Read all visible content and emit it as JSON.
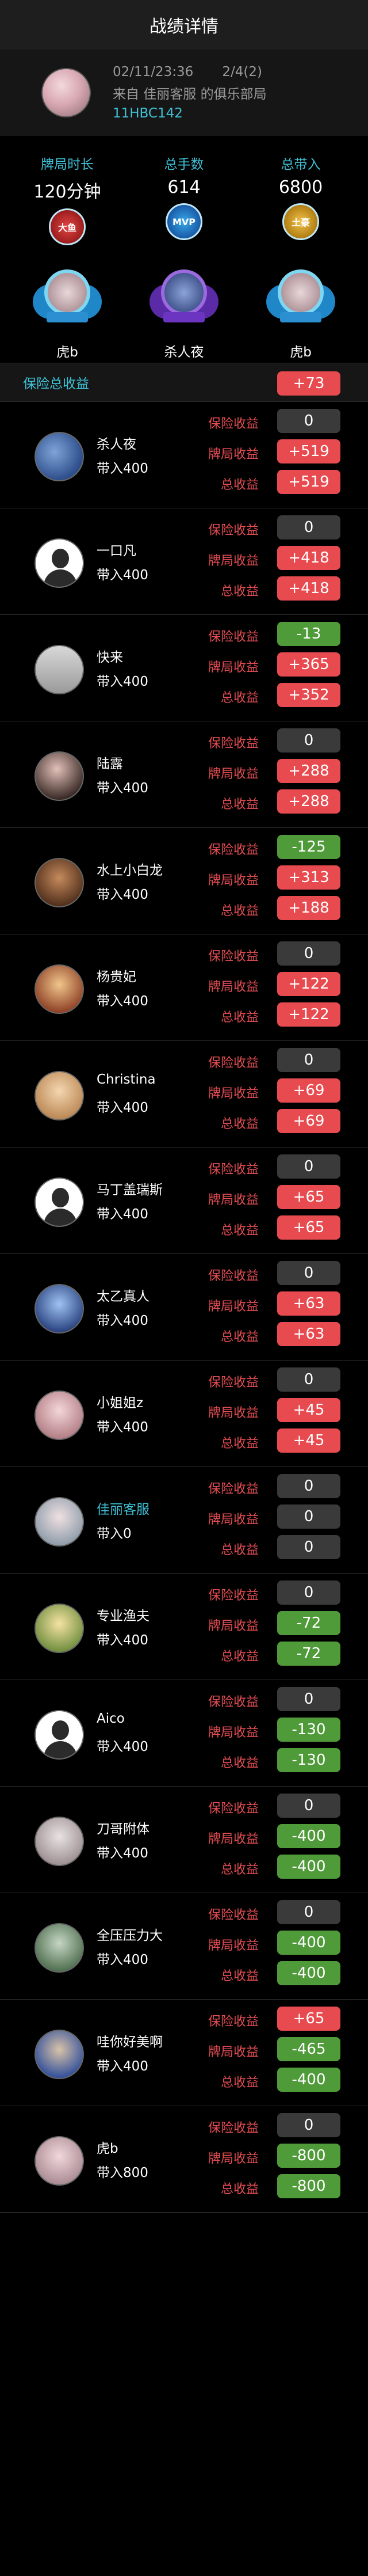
{
  "header": {
    "title": "战绩详情"
  },
  "game": {
    "datetime": "02/11/23:36",
    "hands_ratio": "2/4(2)",
    "club_line": "来自 佳丽客服 的俱乐部局",
    "game_id": "11HBC142"
  },
  "summary": {
    "duration": {
      "label": "牌局时长",
      "value": "120分钟",
      "badge": "大鱼"
    },
    "hands": {
      "label": "总手数",
      "value": "614",
      "badge": "MVP"
    },
    "buyin": {
      "label": "总带入",
      "value": "6800",
      "badge": "土豪"
    },
    "winners": [
      "虎b",
      "杀人夜",
      "虎b"
    ]
  },
  "insurance_total": {
    "label": "保险总收益",
    "value": "+73"
  },
  "labels": {
    "insurance": "保险收益",
    "hand": "牌局收益",
    "total": "总收益"
  },
  "players": [
    {
      "name": "杀人夜",
      "buyin": "带入400",
      "insurance": "0",
      "hand": "+519",
      "total": "+519"
    },
    {
      "name": "一口凡",
      "buyin": "带入400",
      "insurance": "0",
      "hand": "+418",
      "total": "+418"
    },
    {
      "name": "快来",
      "buyin": "带入400",
      "insurance": "-13",
      "hand": "+365",
      "total": "+352"
    },
    {
      "name": "陆露",
      "buyin": "带入400",
      "insurance": "0",
      "hand": "+288",
      "total": "+288"
    },
    {
      "name": "水上小白龙",
      "buyin": "带入400",
      "insurance": "-125",
      "hand": "+313",
      "total": "+188"
    },
    {
      "name": "杨贵妃",
      "buyin": "带入400",
      "insurance": "0",
      "hand": "+122",
      "total": "+122"
    },
    {
      "name": "Christina",
      "buyin": "带入400",
      "insurance": "0",
      "hand": "+69",
      "total": "+69"
    },
    {
      "name": "马丁盖瑞斯",
      "buyin": "带入400",
      "insurance": "0",
      "hand": "+65",
      "total": "+65"
    },
    {
      "name": "太乙真人",
      "buyin": "带入400",
      "insurance": "0",
      "hand": "+63",
      "total": "+63"
    },
    {
      "name": "小姐姐z",
      "buyin": "带入400",
      "insurance": "0",
      "hand": "+45",
      "total": "+45"
    },
    {
      "name": "佳丽客服",
      "buyin": "带入0",
      "insurance": "0",
      "hand": "0",
      "total": "0"
    },
    {
      "name": "专业渔夫",
      "buyin": "带入400",
      "insurance": "0",
      "hand": "-72",
      "total": "-72"
    },
    {
      "name": "Aico",
      "buyin": "带入400",
      "insurance": "0",
      "hand": "-130",
      "total": "-130"
    },
    {
      "name": "刀哥附体",
      "buyin": "带入400",
      "insurance": "0",
      "hand": "-400",
      "total": "-400"
    },
    {
      "name": "全压压力大",
      "buyin": "带入400",
      "insurance": "0",
      "hand": "-400",
      "total": "-400"
    },
    {
      "name": "哇你好美啊",
      "buyin": "带入400",
      "insurance": "+65",
      "hand": "-465",
      "total": "-400"
    },
    {
      "name": "虎b",
      "buyin": "带入800",
      "insurance": "0",
      "hand": "-800",
      "total": "-800"
    }
  ],
  "colors": {
    "accent": "#3fc1d6",
    "positive": "#e84b4f",
    "negative": "#4f9a39",
    "zero": "#3a3a3a",
    "metric_label": "#e34d52"
  }
}
